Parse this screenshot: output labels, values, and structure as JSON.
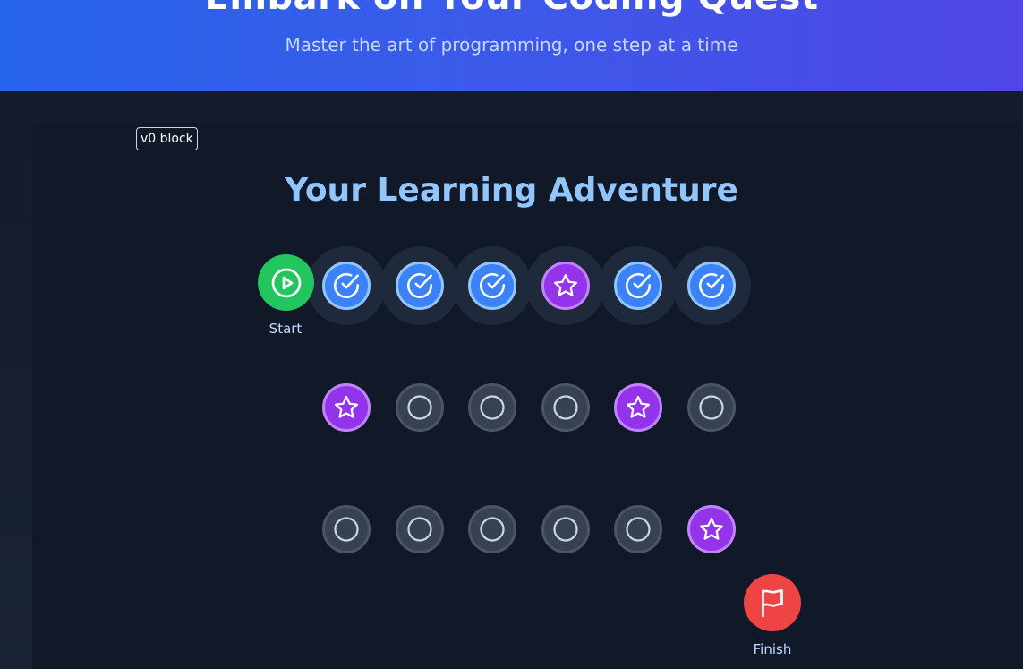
{
  "hero": {
    "title": "Embark on Your Coding Quest",
    "subtitle": "Master the art of programming, one step at a time"
  },
  "badge": "v0 block",
  "adventure": {
    "title": "Your Learning Adventure",
    "start_label": "Start",
    "finish_label": "Finish",
    "rows": [
      [
        "completed",
        "completed",
        "completed",
        "milestone",
        "completed",
        "completed"
      ],
      [
        "milestone",
        "locked",
        "locked",
        "locked",
        "milestone",
        "locked"
      ],
      [
        "locked",
        "locked",
        "locked",
        "locked",
        "locked",
        "milestone"
      ]
    ]
  },
  "colors": {
    "hero_gradient_start": "#2563eb",
    "hero_gradient_end": "#4f46e5",
    "completed": "#3b82f6",
    "milestone": "#9333ea",
    "locked": "#374151",
    "start": "#22c55e",
    "finish": "#ef4444",
    "title": "#93c5fd"
  },
  "icons": {
    "start": "play-circle-icon",
    "completed": "check-circle-icon",
    "milestone": "star-icon",
    "locked": "circle-icon",
    "finish": "flag-icon"
  }
}
